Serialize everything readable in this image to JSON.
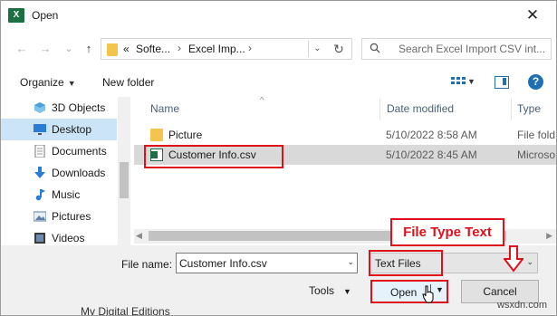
{
  "window": {
    "title": "Open",
    "app_icon_text": "X",
    "close_glyph": "✕"
  },
  "nav": {
    "back_glyph": "←",
    "forward_glyph": "→",
    "recent_glyph": "⌄",
    "up_glyph": "↑"
  },
  "address_bar": {
    "overflow": "«",
    "crumbs": [
      "Softe...",
      "Excel Imp..."
    ],
    "separator": "›",
    "dropdown_glyph": "⌄",
    "refresh_glyph": "↻"
  },
  "search": {
    "placeholder": "Search Excel Import CSV int..."
  },
  "toolbar": {
    "organize_label": "Organize",
    "new_folder_label": "New folder",
    "dropdown_glyph": "▼",
    "help_glyph": "?"
  },
  "navigation_pane": {
    "items": [
      {
        "label": "3D Objects",
        "icon": "3d-objects-icon",
        "selected": false
      },
      {
        "label": "Desktop",
        "icon": "desktop-icon",
        "selected": true
      },
      {
        "label": "Documents",
        "icon": "documents-icon",
        "selected": false
      },
      {
        "label": "Downloads",
        "icon": "downloads-icon",
        "selected": false
      },
      {
        "label": "Music",
        "icon": "music-icon",
        "selected": false
      },
      {
        "label": "Pictures",
        "icon": "pictures-icon",
        "selected": false
      },
      {
        "label": "Videos",
        "icon": "videos-icon",
        "selected": false
      }
    ]
  },
  "file_list": {
    "columns": [
      "Name",
      "Date modified",
      "Type"
    ],
    "sort_glyph": "^",
    "rows": [
      {
        "name": "Picture",
        "date": "5/10/2022 8:58 AM",
        "type": "File fold",
        "icon": "folder-icon",
        "selected": false
      },
      {
        "name": "Customer Info.csv",
        "date": "5/10/2022 8:45 AM",
        "type": "Microso",
        "icon": "csv-file-icon",
        "selected": true
      }
    ]
  },
  "scrollbar": {
    "left_glyph": "◀",
    "right_glyph": "▶"
  },
  "bottom": {
    "file_name_label": "File name:",
    "file_name_value": "Customer Info.csv",
    "file_type_value": "Text Files",
    "tools_label": "Tools",
    "open_label": "Open",
    "cancel_label": "Cancel",
    "dropdown_glyph": "⌄"
  },
  "annotation": {
    "label": "File Type Text"
  },
  "background": {
    "text": "My Digital Editions"
  },
  "watermark": "wsxdn.com",
  "colors": {
    "highlight_red": "#e0101a",
    "selection_blue": "#cce4f7",
    "excel_green": "#1d6f42",
    "folder_yellow": "#f4c54e"
  }
}
